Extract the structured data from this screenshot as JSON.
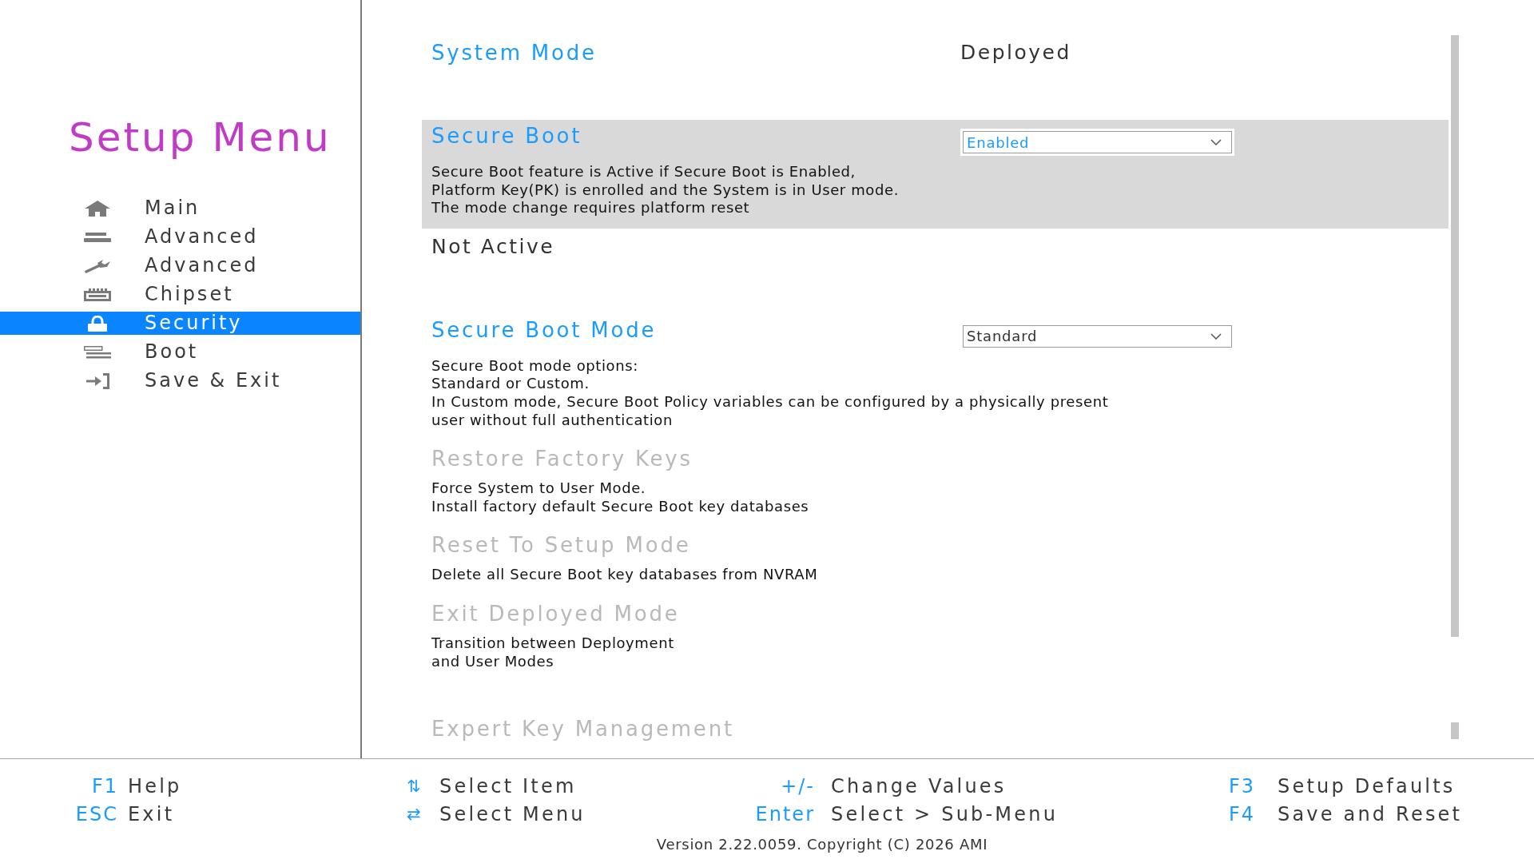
{
  "sidebar": {
    "title": "Setup Menu",
    "items": [
      {
        "label": "Main",
        "kind": "home",
        "selected": false
      },
      {
        "label": "Advanced",
        "kind": "bars",
        "selected": false
      },
      {
        "label": "Advanced",
        "kind": "wrench",
        "selected": false
      },
      {
        "label": "Chipset",
        "kind": "chip",
        "selected": false
      },
      {
        "label": "Security",
        "kind": "lock",
        "selected": true
      },
      {
        "label": "Boot",
        "kind": "drive",
        "selected": false
      },
      {
        "label": "Save & Exit",
        "kind": "exit",
        "selected": false
      }
    ]
  },
  "settings": [
    {
      "kind": "value",
      "label": "System Mode",
      "value": "Deployed",
      "selected": false,
      "disabled": false
    },
    {
      "kind": "dropdown",
      "label": "Secure Boot",
      "value": "Enabled",
      "selected": true,
      "disabled": false,
      "help": "Secure Boot feature is Active if Secure Boot is Enabled,\nPlatform Key(PK) is enrolled and the System is in User mode.\nThe mode change requires platform reset"
    },
    {
      "kind": "status",
      "value": "Not Active",
      "selected": false
    },
    {
      "kind": "dropdown",
      "label": "Secure Boot Mode",
      "value": "Standard",
      "selected": false,
      "disabled": false,
      "help": "Secure Boot mode options:\nStandard or Custom.\nIn Custom mode, Secure Boot Policy variables can be configured by a physically present\nuser without full authentication"
    },
    {
      "kind": "action",
      "label": "Restore Factory Keys",
      "selected": false,
      "disabled": true,
      "help": "Force System to User Mode.\nInstall factory default Secure Boot key databases"
    },
    {
      "kind": "action",
      "label": "Reset To Setup Mode",
      "selected": false,
      "disabled": true,
      "help": "Delete all Secure Boot key databases from NVRAM"
    },
    {
      "kind": "action",
      "label": "Exit Deployed Mode",
      "selected": false,
      "disabled": true,
      "help": "Transition between Deployment\nand User Modes"
    },
    {
      "kind": "action",
      "label": "Expert Key Management",
      "selected": false,
      "disabled": true
    }
  ],
  "footer": {
    "shortcut_columns": [
      {
        "shortcuts": [
          {
            "key": "F1",
            "action": "Help"
          },
          {
            "key": "ESC",
            "action": "Exit"
          }
        ]
      },
      {
        "shortcuts": [
          {
            "key": "⇅",
            "action": "Select Item"
          },
          {
            "key": "⇄",
            "action": "Select Menu"
          }
        ]
      },
      {
        "shortcuts": [
          {
            "key": "+/-",
            "action": "Change Values"
          },
          {
            "key": "Enter",
            "action": "Select > Sub-Menu"
          }
        ]
      },
      {
        "shortcuts": [
          {
            "key": "F3",
            "action": "Setup Defaults"
          },
          {
            "key": "F4",
            "action": "Save and Reset"
          }
        ]
      }
    ],
    "version": "Version 2.22.0059. Copyright (C) 2026 AMI"
  }
}
